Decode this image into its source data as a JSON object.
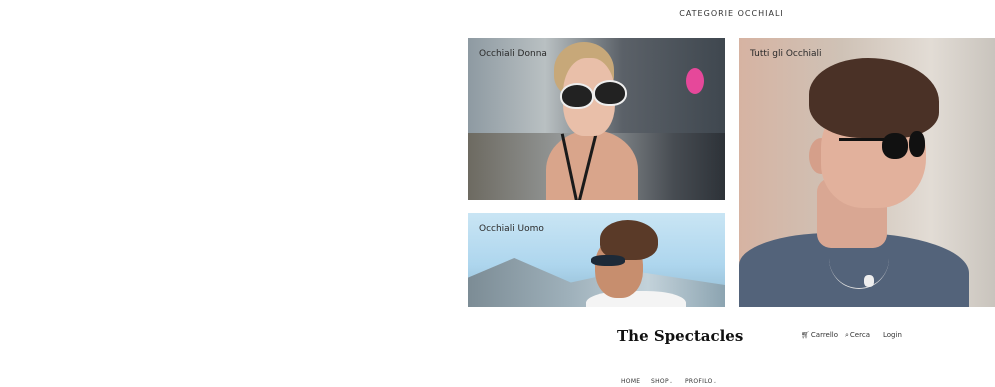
{
  "section": {
    "title": "CATEGORIE OCCHIALI"
  },
  "categories": [
    {
      "label": "Occhiali Donna"
    },
    {
      "label": "Tutti gli Occhiali"
    },
    {
      "label": "Occhiali Uomo"
    }
  ],
  "header": {
    "brand": "The Spectacles",
    "cart": "Carrello",
    "search": "Cerca",
    "login": "Login"
  },
  "nav": {
    "home": "HOME",
    "shop": "SHOP",
    "profilo": "PROFILO"
  },
  "icons": {
    "cart": "cart-icon",
    "search": "search-icon",
    "chevron": "chevron-down-icon"
  }
}
